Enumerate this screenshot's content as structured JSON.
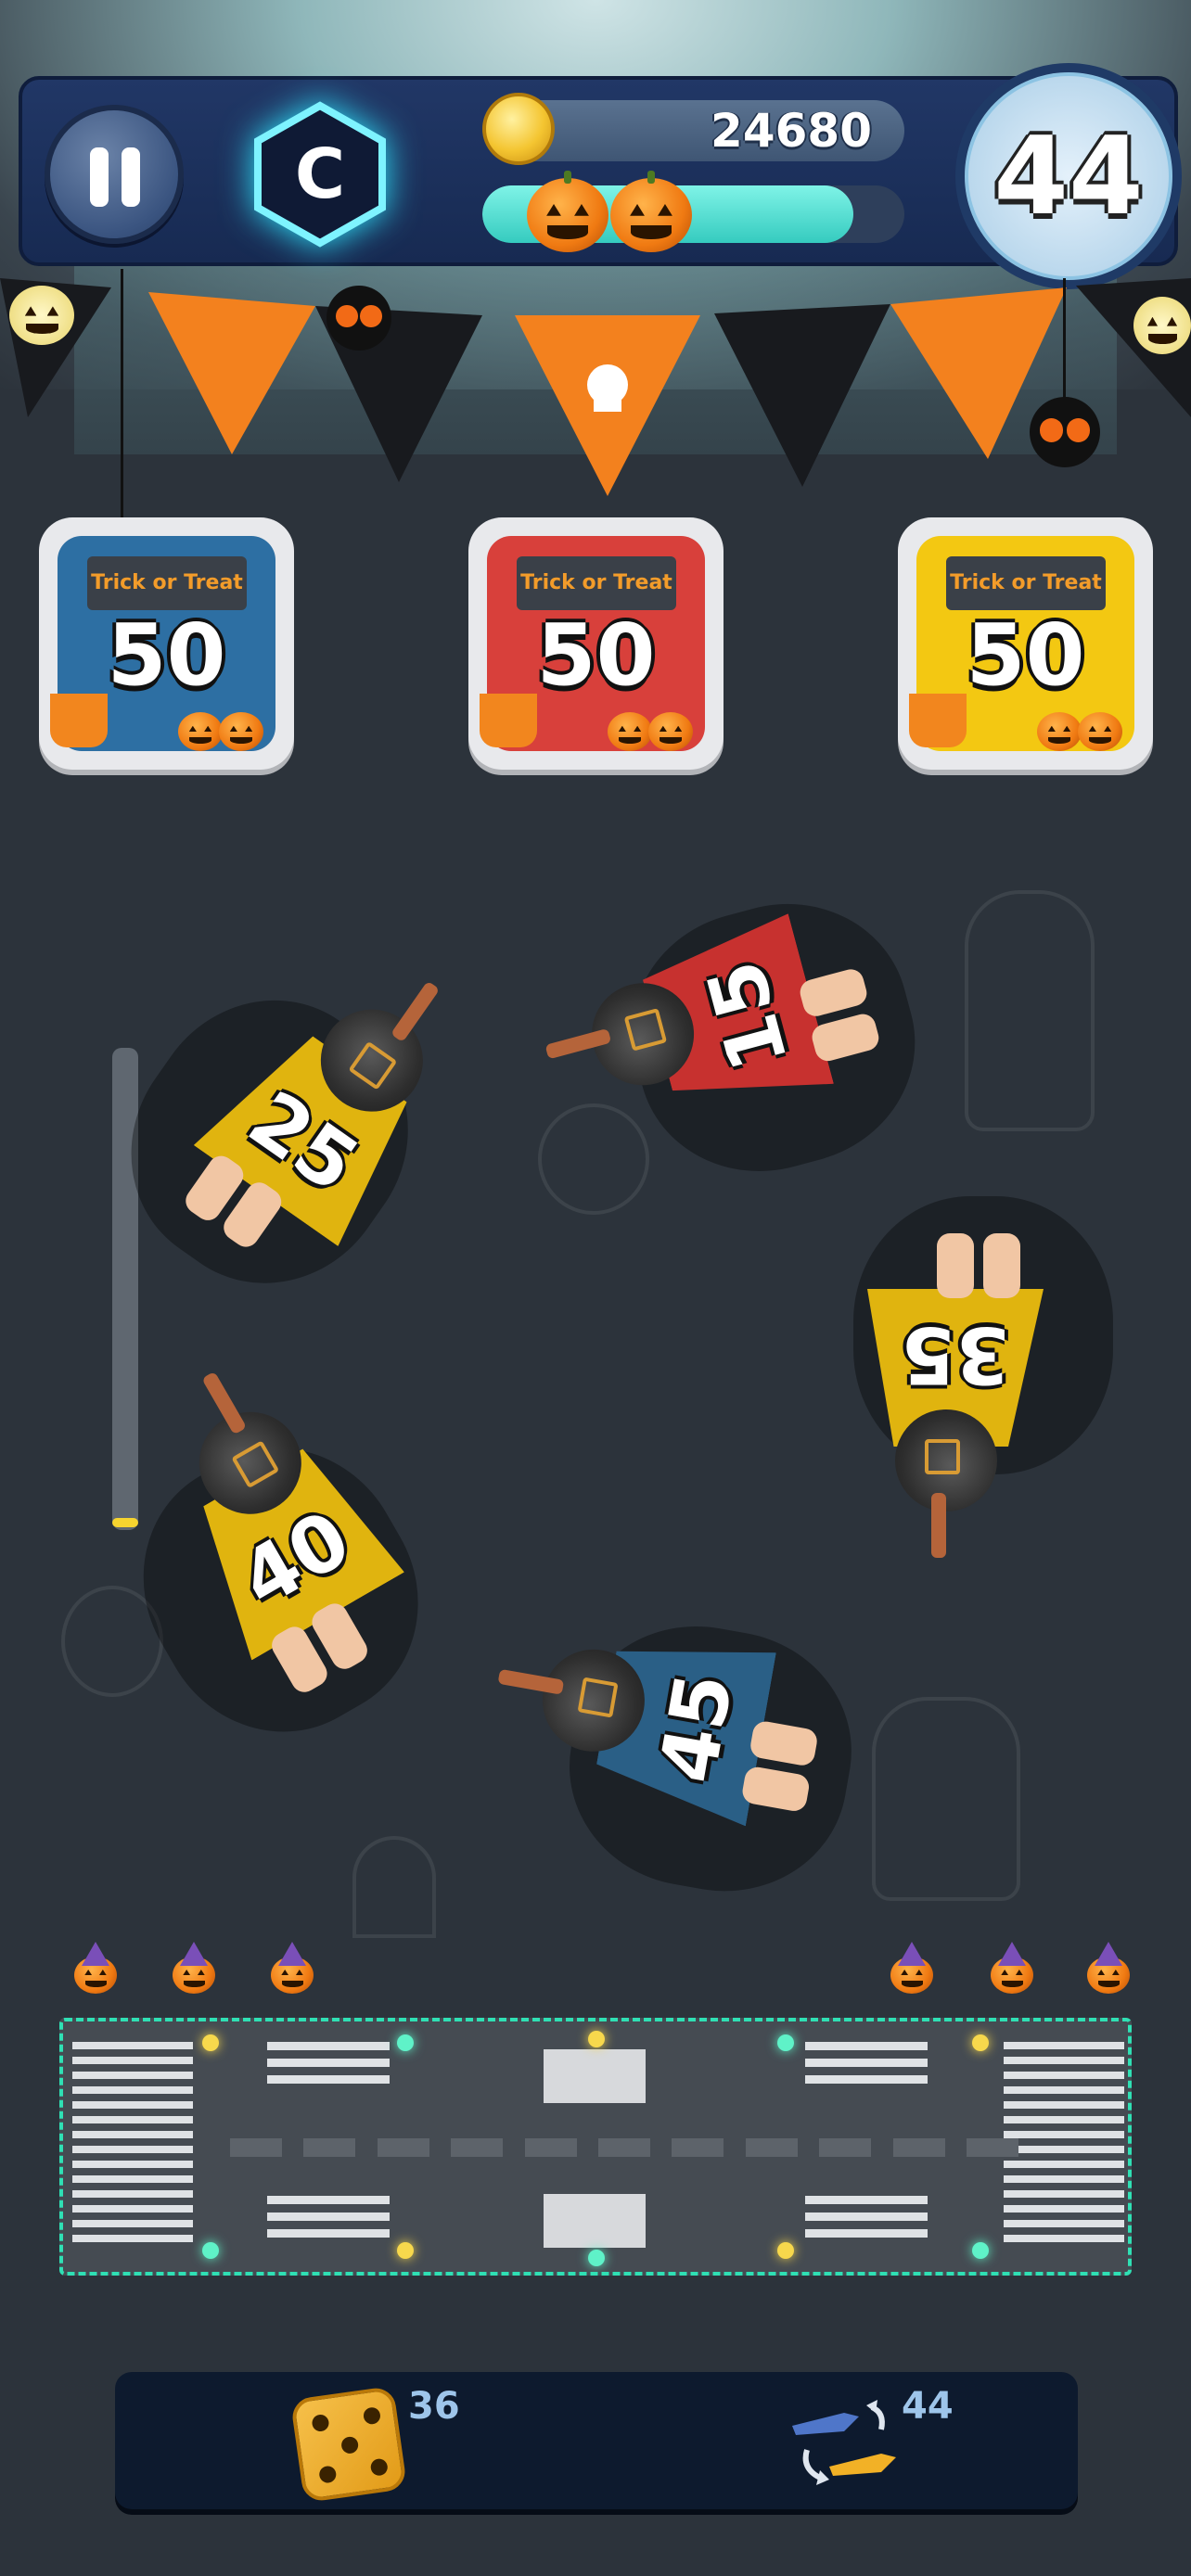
{
  "hud": {
    "level_letter": "C",
    "coins": "24680",
    "progress_percent": 88,
    "timer": "44"
  },
  "goals": [
    {
      "color": "blue",
      "count": "50",
      "sign": "Trick or Treat"
    },
    {
      "color": "red",
      "count": "50",
      "sign": "Trick or Treat"
    },
    {
      "color": "yellow",
      "count": "50",
      "sign": "Trick or Treat"
    }
  ],
  "witches": [
    {
      "id": "25",
      "cape": "yellow",
      "label": "25"
    },
    {
      "id": "15",
      "cape": "red",
      "label": "15"
    },
    {
      "id": "35",
      "cape": "yellow",
      "label": "35"
    },
    {
      "id": "40",
      "cape": "yellow",
      "label": "40"
    },
    {
      "id": "45",
      "cape": "blue",
      "label": "45"
    }
  ],
  "booster_bar": {
    "dice_count": "36",
    "swap_count": "44"
  },
  "colors": {
    "blue": "#2d6fa3",
    "red": "#d8403b",
    "yellow": "#f3c812",
    "cape_yellow": "#e0b40f",
    "cape_red": "#c7312f",
    "cape_blue": "#2a5f86",
    "accent_teal": "#2fe0b4"
  },
  "icons": [
    "pause-icon",
    "level-hexagon-icon",
    "coin-icon",
    "pumpkin-icon",
    "dice-icon",
    "swap-icon",
    "spider-icon"
  ]
}
